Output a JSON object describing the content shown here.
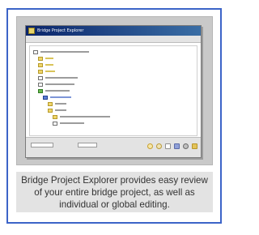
{
  "screenshot": {
    "window_title": "Bridge Project Explorer",
    "icons": [
      "document-icon",
      "folder-icon",
      "bridge-icon",
      "circle-tool-icon",
      "help-icon"
    ]
  },
  "caption": {
    "text": "Bridge Project Explorer provides easy review of your entire bridge project, as well as individual or global editing."
  },
  "colors": {
    "border_accent": "#3c64c8",
    "caption_bg": "#e3e3e3",
    "titlebar": "#0a246a"
  }
}
